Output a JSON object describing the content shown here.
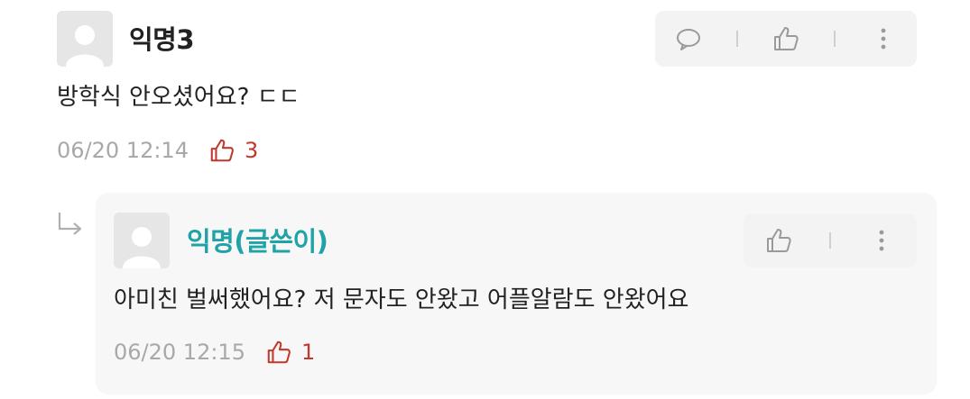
{
  "comment": {
    "author": "익명3",
    "body": "방학식 안오셨어요? ㄷㄷ",
    "timestamp": "06/20 12:14",
    "like_count": "3",
    "actions": [
      "speech-bubble-icon",
      "thumbs-up-icon",
      "more-vertical-icon"
    ]
  },
  "reply": {
    "author": "익명(글쓴이)",
    "body": "아미친 벌써했어요? 저 문자도 안왔고 어플알람도 안왔어요",
    "timestamp": "06/20 12:15",
    "like_count": "1",
    "actions": [
      "thumbs-up-icon",
      "more-vertical-icon"
    ]
  },
  "colors": {
    "author_default": "#222222",
    "author_op": "#1fa3a6",
    "like": "#c0392b",
    "meta": "#a8a8a8"
  }
}
